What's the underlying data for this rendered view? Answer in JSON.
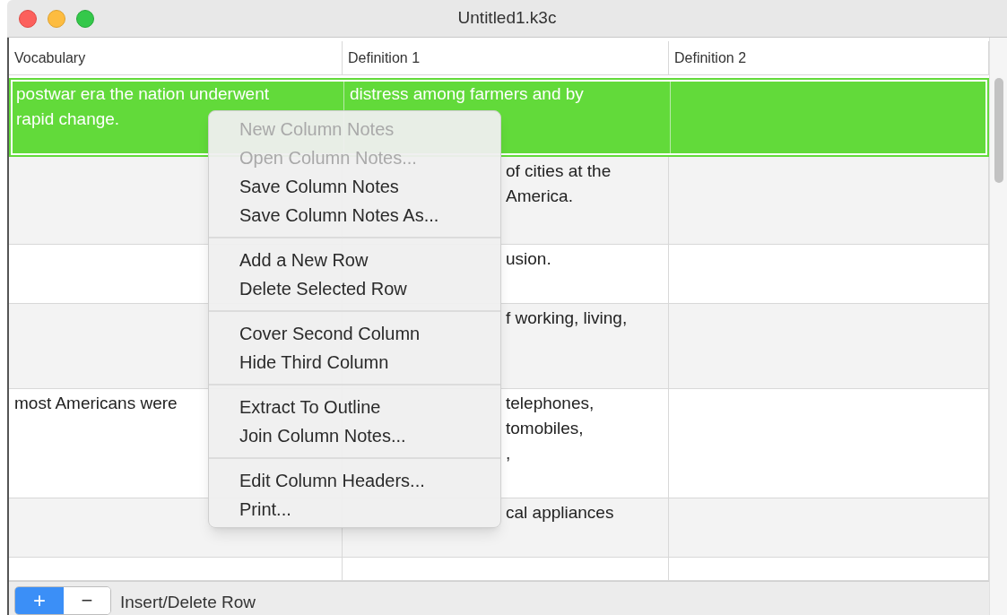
{
  "window": {
    "title": "Untitled1.k3c"
  },
  "table": {
    "columns": [
      "Vocabulary",
      "Definition 1",
      "Definition 2"
    ],
    "rows": [
      {
        "selected": true,
        "vocabulary": "postwar era the nation underwent\nrapid change.",
        "definition_1": {
          "kind": "full",
          "text": "distress among farmers and by"
        }
      },
      {
        "selected": false,
        "definition_1": {
          "kind": "clipped",
          "text": "of cities at the\nAmerica."
        }
      },
      {
        "selected": false,
        "definition_1": {
          "kind": "clipped",
          "text": "usion."
        }
      },
      {
        "selected": false,
        "definition_1": {
          "kind": "clipped",
          "text": "f working, living,"
        }
      },
      {
        "selected": false,
        "vocabulary": "most Americans were",
        "definition_1": {
          "kind": "clipped",
          "text": "telephones,\ntomobiles,\n,"
        }
      },
      {
        "selected": false,
        "definition_1": {
          "kind": "clipped",
          "text": "cal appliances"
        }
      },
      {
        "selected": false
      }
    ]
  },
  "context_menu": {
    "groups": [
      [
        {
          "label": "New Column Notes",
          "disabled": true
        },
        {
          "label": "Open Column Notes...",
          "disabled": true
        },
        {
          "label": "Save Column Notes",
          "disabled": false
        },
        {
          "label": "Save Column Notes As...",
          "disabled": false
        }
      ],
      [
        {
          "label": "Add a New Row",
          "disabled": false
        },
        {
          "label": "Delete Selected Row",
          "disabled": false
        }
      ],
      [
        {
          "label": "Cover Second Column",
          "disabled": false
        },
        {
          "label": "Hide Third Column",
          "disabled": false
        }
      ],
      [
        {
          "label": "Extract To Outline",
          "disabled": false
        },
        {
          "label": "Join Column Notes...",
          "disabled": false
        }
      ],
      [
        {
          "label": "Edit Column Headers...",
          "disabled": false
        },
        {
          "label": "Print...",
          "disabled": false
        }
      ]
    ]
  },
  "bottom_bar": {
    "add_button": "+",
    "remove_button": "−",
    "label": "Insert/Delete Row"
  }
}
